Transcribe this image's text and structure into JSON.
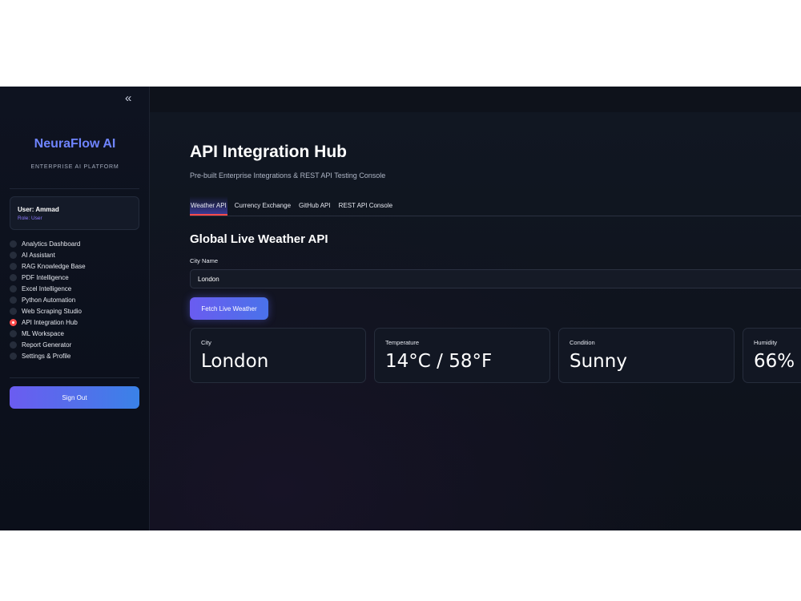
{
  "sidebar": {
    "collapse_glyph": "«",
    "brand": "NeuraFlow AI",
    "brand_subtitle": "ENTERPRISE AI PLATFORM",
    "user": {
      "name": "User: Ammad",
      "role": "Role: User"
    },
    "nav": [
      {
        "label": "Analytics Dashboard",
        "active": false
      },
      {
        "label": "AI Assistant",
        "active": false
      },
      {
        "label": "RAG Knowledge Base",
        "active": false
      },
      {
        "label": "PDF Intelligence",
        "active": false
      },
      {
        "label": "Excel Intelligence",
        "active": false
      },
      {
        "label": "Python Automation",
        "active": false
      },
      {
        "label": "Web Scraping Studio",
        "active": false
      },
      {
        "label": "API Integration Hub",
        "active": true
      },
      {
        "label": "ML Workspace",
        "active": false
      },
      {
        "label": "Report Generator",
        "active": false
      },
      {
        "label": "Settings & Profile",
        "active": false
      }
    ],
    "signout_label": "Sign Out"
  },
  "main": {
    "title": "API Integration Hub",
    "subtitle": "Pre-built Enterprise Integrations & REST API Testing Console",
    "tabs": [
      {
        "label": "Weather API",
        "active": true
      },
      {
        "label": "Currency Exchange",
        "active": false
      },
      {
        "label": "GitHub API",
        "active": false
      },
      {
        "label": "REST API Console",
        "active": false
      }
    ],
    "section_title": "Global Live Weather API",
    "city_field": {
      "label": "City Name",
      "value": "London"
    },
    "fetch_label": "Fetch Live Weather",
    "metrics": [
      {
        "label": "City",
        "value": "London"
      },
      {
        "label": "Temperature",
        "value": "14°C / 58°F"
      },
      {
        "label": "Condition",
        "value": "Sunny"
      },
      {
        "label": "Humidity",
        "value": "66%"
      }
    ]
  },
  "colors": {
    "brand": "#6f84ff",
    "active_radio": "#ff4b4b",
    "button_gradient_start": "#6a5cf0",
    "button_gradient_end": "#3a82e8"
  }
}
